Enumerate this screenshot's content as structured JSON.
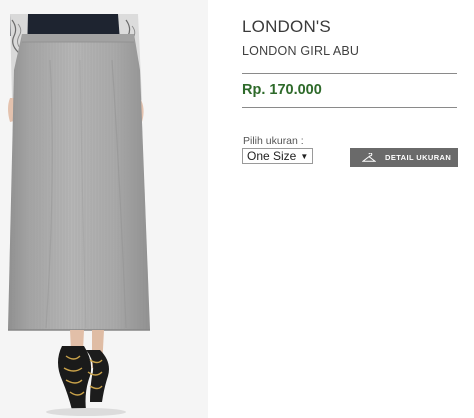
{
  "product": {
    "brand": "LONDON'S",
    "name": "LONDON GIRL ABU",
    "price": "Rp. 170.000",
    "image_alt": "grey long skirt",
    "price_color": "#2e6a2a"
  },
  "size": {
    "label": "Pilih ukuran :",
    "selected": "One Size",
    "detail_button_label": "DETAIL UKURAN",
    "detail_icon": "hanger-icon"
  }
}
